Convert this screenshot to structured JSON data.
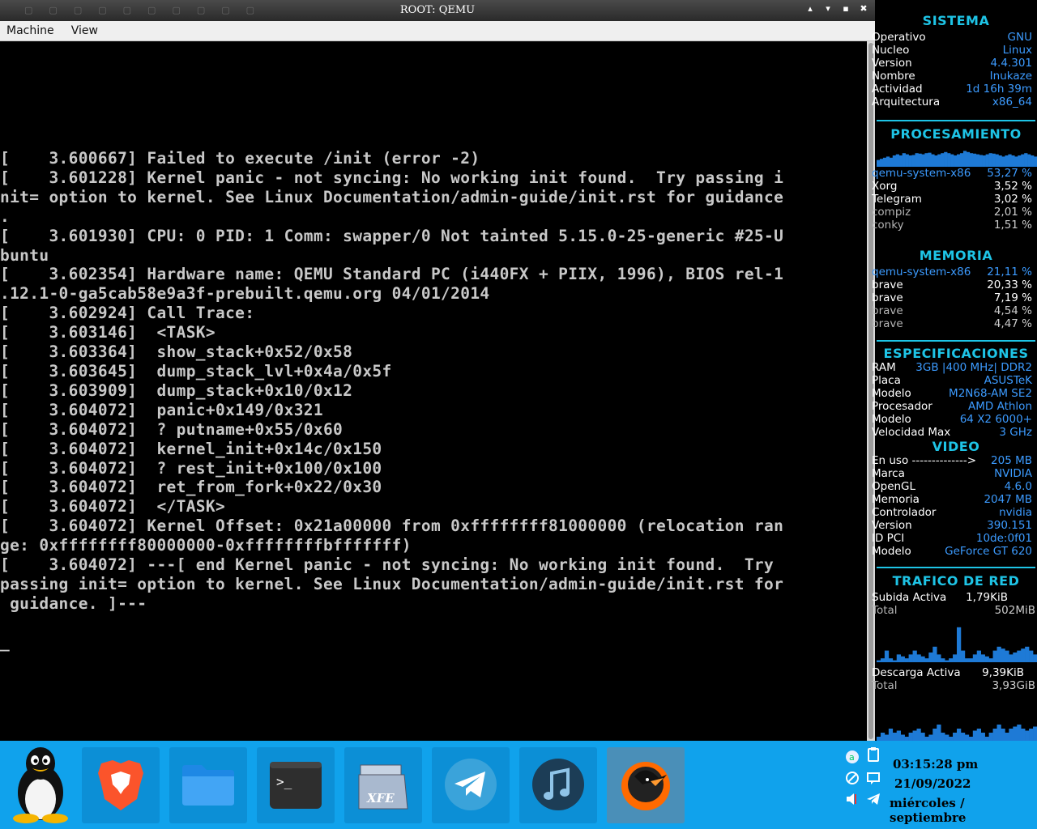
{
  "window": {
    "title": "ROOT: QEMU",
    "menu": [
      "Machine",
      "View"
    ],
    "buttons": [
      "▴",
      "▾",
      "▪",
      "✖"
    ]
  },
  "terminal": {
    "lines": [
      "[    3.600667] Failed to execute /init (error -2)",
      "[    3.601228] Kernel panic - not syncing: No working init found.  Try passing i",
      "nit= option to kernel. See Linux Documentation/admin-guide/init.rst for guidance",
      ".",
      "[    3.601930] CPU: 0 PID: 1 Comm: swapper/0 Not tainted 5.15.0-25-generic #25-U",
      "buntu",
      "[    3.602354] Hardware name: QEMU Standard PC (i440FX + PIIX, 1996), BIOS rel-1",
      ".12.1-0-ga5cab58e9a3f-prebuilt.qemu.org 04/01/2014",
      "[    3.602924] Call Trace:",
      "[    3.603146]  <TASK>",
      "[    3.603364]  show_stack+0x52/0x58",
      "[    3.603645]  dump_stack_lvl+0x4a/0x5f",
      "[    3.603909]  dump_stack+0x10/0x12",
      "[    3.604072]  panic+0x149/0x321",
      "[    3.604072]  ? putname+0x55/0x60",
      "[    3.604072]  kernel_init+0x14c/0x150",
      "[    3.604072]  ? rest_init+0x100/0x100",
      "[    3.604072]  ret_from_fork+0x22/0x30",
      "[    3.604072]  </TASK>",
      "[    3.604072] Kernel Offset: 0x21a00000 from 0xffffffff81000000 (relocation ran",
      "ge: 0xffffffff80000000-0xffffffffbfffffff)",
      "[    3.604072] ---[ end Kernel panic - not syncing: No working init found.  Try ",
      "passing init= option to kernel. See Linux Documentation/admin-guide/init.rst for",
      " guidance. ]---",
      "",
      "_"
    ]
  },
  "conky": {
    "sistema": {
      "title": "SISTEMA",
      "rows": [
        {
          "k": "Operativo",
          "v": "GNU"
        },
        {
          "k": "Nucleo",
          "v": "Linux"
        },
        {
          "k": "Version",
          "v": "4.4.301"
        },
        {
          "k": "Nombre",
          "v": "Inukaze"
        },
        {
          "k": "Actividad",
          "v": "1d 16h 39m"
        },
        {
          "k": "Arquitectura",
          "v": "x86_64"
        }
      ]
    },
    "procesamiento": {
      "title": "PROCESAMIENTO",
      "graph": [
        0.3,
        0.35,
        0.4,
        0.45,
        0.4,
        0.5,
        0.55,
        0.5,
        0.6,
        0.55,
        0.5,
        0.52,
        0.6,
        0.58,
        0.55,
        0.6,
        0.62,
        0.55,
        0.5,
        0.55,
        0.6,
        0.65,
        0.6,
        0.55,
        0.5,
        0.55,
        0.6,
        0.7,
        0.65,
        0.6,
        0.58,
        0.55,
        0.52,
        0.5,
        0.55,
        0.6,
        0.58,
        0.55,
        0.5,
        0.45,
        0.5,
        0.55,
        0.5,
        0.45,
        0.5,
        0.55,
        0.6,
        0.55,
        0.5,
        0.45
      ],
      "rows": [
        {
          "k": "qemu-system-x86",
          "v": "53,27 %",
          "hl": true
        },
        {
          "k": "Xorg",
          "v": "3,52 %"
        },
        {
          "k": "Telegram",
          "v": "3,02 %"
        },
        {
          "k": "compiz",
          "v": "2,01 %"
        },
        {
          "k": "conky",
          "v": "1,51 %"
        }
      ]
    },
    "memoria": {
      "title": "MEMORIA",
      "rows": [
        {
          "k": "qemu-system-x86",
          "v": "21,11 %",
          "hl": true
        },
        {
          "k": "brave",
          "v": "20,33 %"
        },
        {
          "k": "brave",
          "v": "7,19 %"
        },
        {
          "k": "brave",
          "v": "4,54 %"
        },
        {
          "k": "brave",
          "v": "4,47 %"
        }
      ]
    },
    "especificaciones": {
      "title": "ESPECIFICACIONES",
      "rows": [
        {
          "k": "RAM",
          "v": "3GB |400 MHz| DDR2"
        },
        {
          "k": "Placa",
          "v": "ASUSTeK"
        },
        {
          "k": "Modelo",
          "v": "M2N68-AM SE2"
        },
        {
          "k": "Procesador",
          "v": "AMD Athlon"
        },
        {
          "k": "Modelo",
          "v": "64 X2 6000+"
        },
        {
          "k": "Velocidad Max",
          "v": "3 GHz"
        }
      ]
    },
    "video": {
      "title": "VIDEO",
      "rows": [
        {
          "k": "En uso  -------------->",
          "v": "205 MB"
        },
        {
          "k": "Marca",
          "v": "NVIDIA"
        },
        {
          "k": "OpenGL",
          "v": "4.6.0"
        },
        {
          "k": "Memoria",
          "v": "2047 MB"
        },
        {
          "k": "Controlador",
          "v": "nvidia"
        },
        {
          "k": "Version",
          "v": "390.151"
        },
        {
          "k": "ID PCI",
          "v": "10de:0f01"
        },
        {
          "k": "Modelo",
          "v": "GeForce GT 620"
        }
      ]
    },
    "red": {
      "title": "TRAFICO DE RED",
      "upload": {
        "k": "Subida Activa",
        "v": "1,79KiB",
        "total_k": "Total",
        "total_v": "502MiB"
      },
      "download": {
        "k": "Descarga Activa",
        "v": "9,39KiB",
        "total_k": "Total",
        "total_v": "3,93GiB"
      },
      "up_graph": [
        0.05,
        0.1,
        0.3,
        0.1,
        0.05,
        0.2,
        0.15,
        0.1,
        0.2,
        0.3,
        0.2,
        0.15,
        0.1,
        0.25,
        0.4,
        0.2,
        0.1,
        0.05,
        0.1,
        0.2,
        0.9,
        0.3,
        0.1,
        0.1,
        0.2,
        0.3,
        0.2,
        0.15,
        0.1,
        0.3,
        0.4,
        0.35,
        0.3,
        0.2,
        0.25,
        0.3,
        0.35,
        0.4,
        0.3,
        0.2
      ],
      "down_graph": [
        0.1,
        0.2,
        0.15,
        0.3,
        0.2,
        0.25,
        0.15,
        0.1,
        0.2,
        0.25,
        0.3,
        0.2,
        0.1,
        0.15,
        0.3,
        0.4,
        0.2,
        0.15,
        0.1,
        0.2,
        0.3,
        0.2,
        0.15,
        0.1,
        0.25,
        0.3,
        0.2,
        0.1,
        0.2,
        0.3,
        0.4,
        0.3,
        0.2,
        0.3,
        0.35,
        0.4,
        0.3,
        0.25,
        0.3,
        0.35
      ]
    }
  },
  "taskbar": {
    "apps": [
      {
        "name": "linux-menu-icon"
      },
      {
        "name": "brave-browser-icon"
      },
      {
        "name": "file-manager-icon"
      },
      {
        "name": "terminal-icon"
      },
      {
        "name": "xfe-icon",
        "label": "XFE"
      },
      {
        "name": "telegram-icon"
      },
      {
        "name": "music-player-icon"
      },
      {
        "name": "qemu-icon"
      }
    ],
    "clock": {
      "time": "03:15:28 pm",
      "date": "21/09/2022",
      "day": "miércoles / septiembre"
    },
    "colors": {
      "bar": "#10a2ec",
      "tile": "#0c8fd6",
      "accent": "#1ec4e6",
      "value": "#3c9bff"
    }
  }
}
